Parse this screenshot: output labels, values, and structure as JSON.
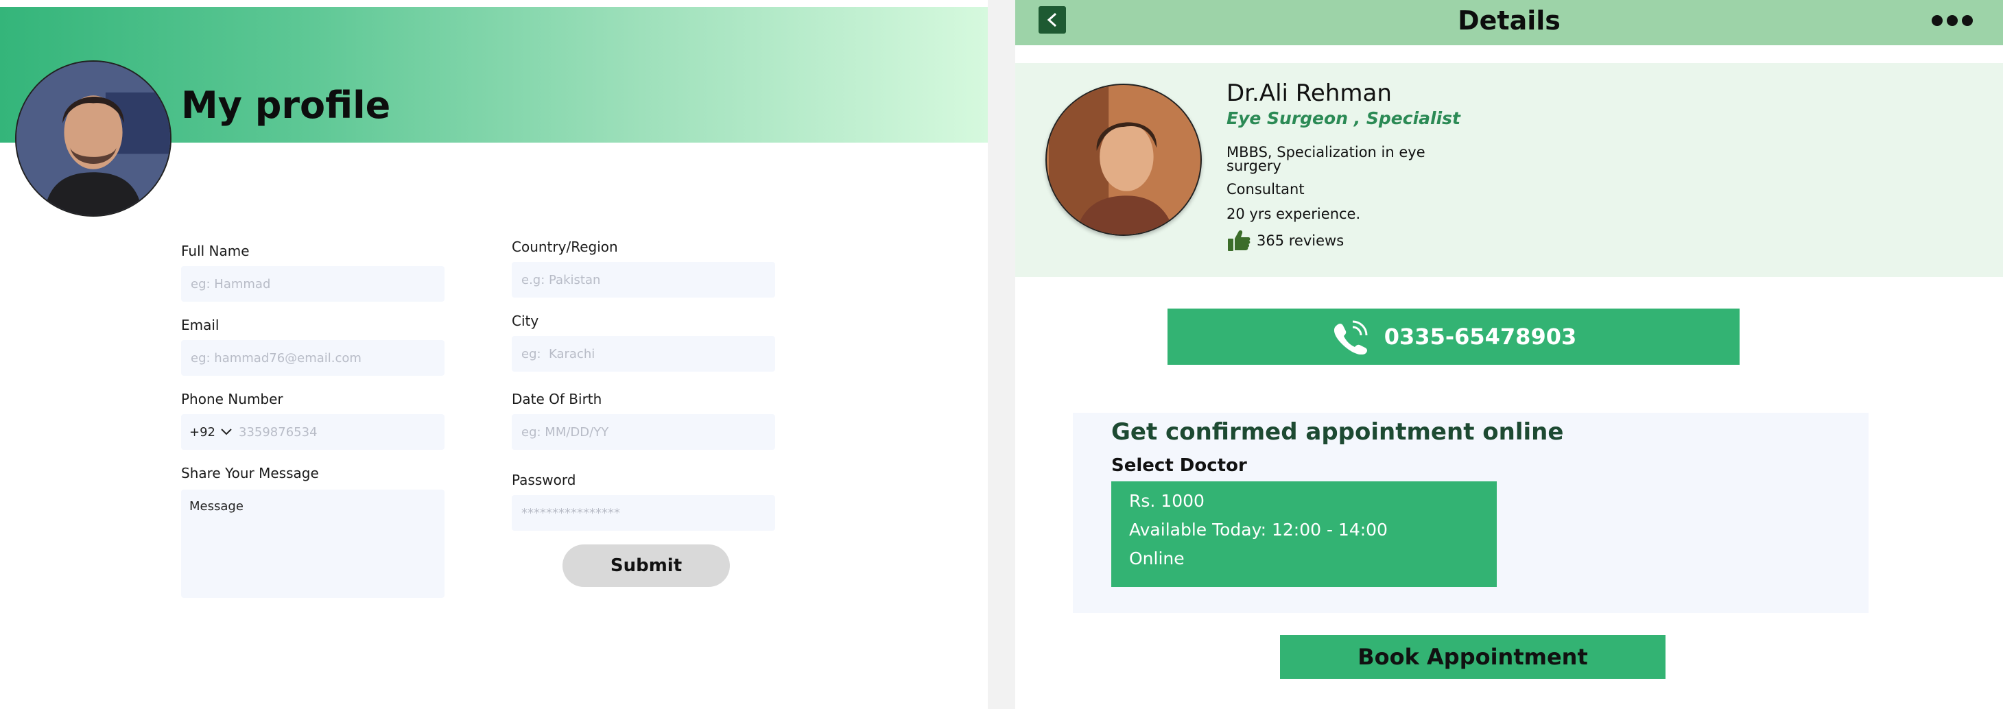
{
  "profile": {
    "title": "My profile",
    "fields": {
      "full_name": {
        "label": "Full Name",
        "placeholder": "eg: Hammad"
      },
      "email": {
        "label": "Email",
        "placeholder": "eg: hammad76@email.com"
      },
      "phone": {
        "label": "Phone Number",
        "code": "+92",
        "placeholder": "3359876534"
      },
      "message": {
        "label": "Share Your Message",
        "placeholder": "Message"
      },
      "country": {
        "label": "Country/Region",
        "placeholder": "e.g: Pakistan"
      },
      "city": {
        "label": "City",
        "placeholder": "eg:  Karachi"
      },
      "dob": {
        "label": "Date Of Birth",
        "placeholder": "eg: MM/DD/YY"
      },
      "password": {
        "label": "Password",
        "placeholder": "****************"
      }
    },
    "submit_label": "Submit"
  },
  "details": {
    "title": "Details",
    "doctor": {
      "name": "Dr.Ali Rehman",
      "specialty": "Eye Surgeon , Specialist",
      "qualification": "MBBS, Specialization in eye surgery",
      "role": "Consultant",
      "experience": "20 yrs experience.",
      "reviews": "365 reviews"
    },
    "phone": "0335-65478903",
    "appointment": {
      "heading": "Get confirmed appointment online",
      "select_label": "Select Doctor",
      "option": {
        "fee": "Rs. 1000",
        "availability": "Available Today: 12:00 - 14:00",
        "mode": "Online"
      }
    },
    "book_label": "Book Appointment"
  },
  "colors": {
    "accent_green": "#33b373",
    "header_green": "#9dd3a8",
    "dark_green": "#1e5a32",
    "field_bg": "#f4f7fd"
  },
  "icons": [
    "back-chevron-icon",
    "more-dots-icon",
    "thumbs-up-icon",
    "phone-call-icon",
    "chevron-down-icon"
  ]
}
